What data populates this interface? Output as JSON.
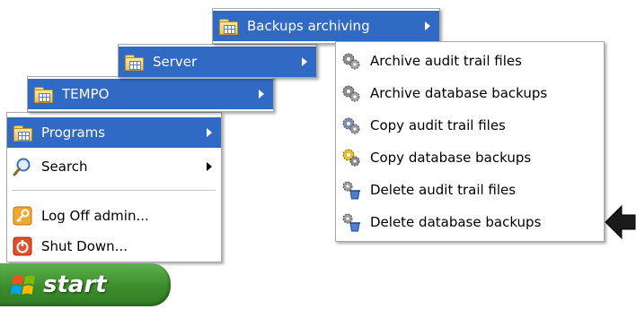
{
  "start_menu": {
    "items": [
      {
        "label": "Programs",
        "icon": "programs-folder-icon"
      },
      {
        "label": "Search",
        "icon": "search-magnifier-icon"
      },
      {
        "label": "Log Off admin...",
        "icon": "log-off-key-icon"
      },
      {
        "label": "Shut Down...",
        "icon": "shut-down-power-icon"
      }
    ]
  },
  "start_button": {
    "label": "start",
    "icon": "windows-flag-icon"
  },
  "programs_menu": {
    "items": [
      {
        "label": "TEMPO",
        "icon": "folder-icon"
      }
    ]
  },
  "tempo_menu": {
    "items": [
      {
        "label": "Server",
        "icon": "folder-icon"
      }
    ]
  },
  "server_menu": {
    "items": [
      {
        "label": "Backups archiving",
        "icon": "folder-icon"
      }
    ]
  },
  "backups_menu": {
    "items": [
      {
        "label": "Archive audit trail files",
        "icon": "archive-gears-icon"
      },
      {
        "label": "Archive database backups",
        "icon": "archive-gears-icon"
      },
      {
        "label": "Copy audit trail files",
        "icon": "copy-gears-icon"
      },
      {
        "label": "Copy database backups",
        "icon": "copy-gears-icon"
      },
      {
        "label": "Delete audit trail files",
        "icon": "delete-gears-trash-icon"
      },
      {
        "label": "Delete database backups",
        "icon": "delete-gears-trash-icon"
      }
    ]
  },
  "annotation": {
    "icon": "pointer-arrow-icon"
  },
  "colors": {
    "selection": "#316ac5",
    "start_green": "#3c8c2c",
    "menu_border": "#a9a9a9"
  }
}
